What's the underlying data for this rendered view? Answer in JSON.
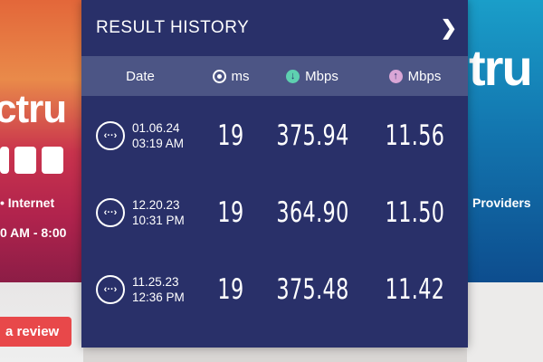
{
  "background": {
    "left_brand": "ctru",
    "left_nav": "• Internet",
    "left_hours": "0 AM - 8:00",
    "review_button": "a review",
    "right_brand": "tru",
    "right_nav": "Providers"
  },
  "panel": {
    "title": "RESULT HISTORY",
    "columns": {
      "date": "Date",
      "ping": "ms",
      "download": "Mbps",
      "upload": "Mbps"
    },
    "rows": [
      {
        "date": "01.06.24",
        "time": "03:19 AM",
        "ping": "19",
        "download": "375.94",
        "upload": "11.56"
      },
      {
        "date": "12.20.23",
        "time": "10:31 PM",
        "ping": "19",
        "download": "364.90",
        "upload": "11.50"
      },
      {
        "date": "11.25.23",
        "time": "12:36 PM",
        "ping": "19",
        "download": "375.48",
        "upload": "11.42"
      }
    ]
  },
  "colors": {
    "panel_bg": "#293069",
    "header_bar": "#4c5585",
    "download_icon": "#5ed0b0",
    "upload_icon": "#d9a6d6"
  }
}
